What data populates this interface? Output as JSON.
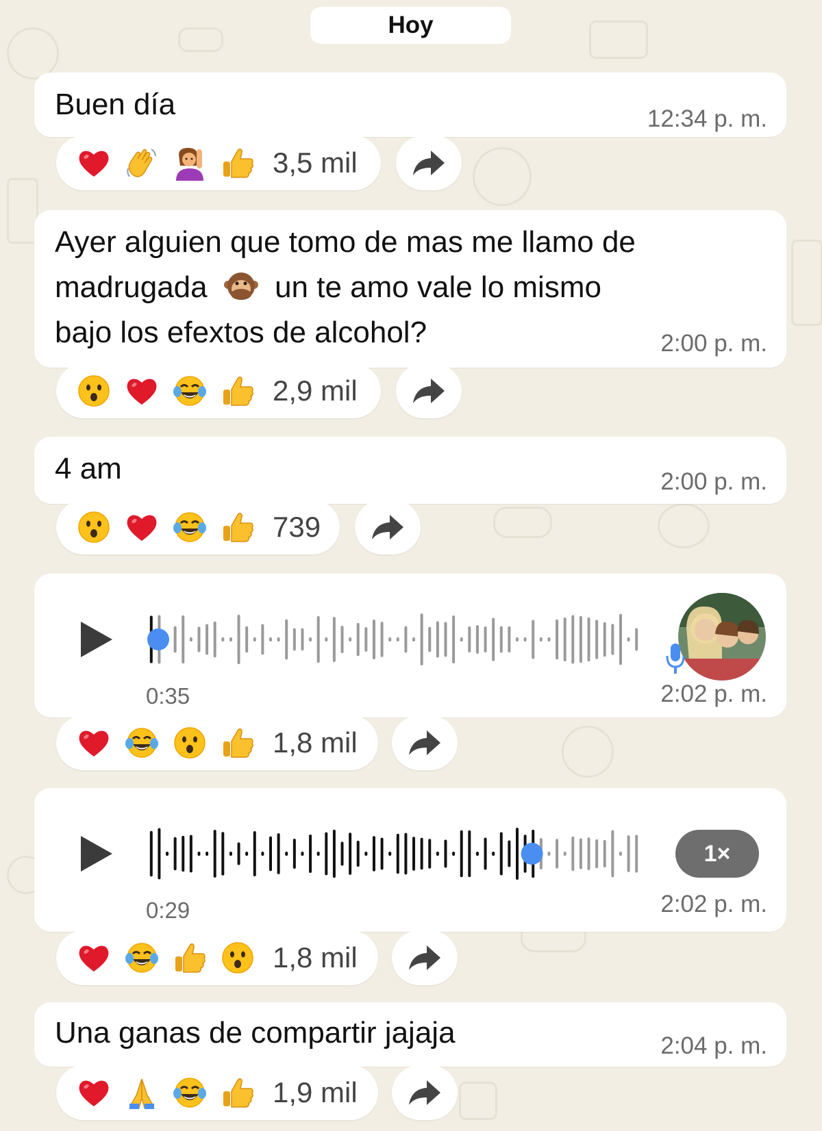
{
  "date_label": "Hoy",
  "colors": {
    "background": "#f3eee4",
    "bubble": "#ffffff",
    "waveform_played": "#111111",
    "waveform_unplayed": "#9a9a9a",
    "progress_dot": "#4a8ef1",
    "speed_badge": "#6e6e6e"
  },
  "messages": [
    {
      "type": "text",
      "lines": [
        "Buen día"
      ],
      "time": "12:34 p. m.",
      "reactions": {
        "emojis": [
          "heart",
          "wave",
          "raising-hand",
          "thumbs-up"
        ],
        "count": "3,5 mil"
      }
    },
    {
      "type": "text",
      "lines": [
        "Ayer alguien que tomo de mas me llamo de",
        "madrugada",
        "un te amo vale lo mismo",
        "bajo los efextos de alcohol?"
      ],
      "inline_emoji": "see-no-evil-monkey",
      "time": "2:00 p. m.",
      "reactions": {
        "emojis": [
          "surprised",
          "heart",
          "tears-of-joy",
          "thumbs-up"
        ],
        "count": "2,9 mil"
      }
    },
    {
      "type": "text",
      "lines": [
        "4 am"
      ],
      "time": "2:00 p. m.",
      "reactions": {
        "emojis": [
          "surprised",
          "heart",
          "tears-of-joy",
          "thumbs-up"
        ],
        "count": "739"
      }
    },
    {
      "type": "voice",
      "duration": "0:35",
      "time": "2:02 p. m.",
      "progress": 0.0,
      "status_icon": "microphone-icon",
      "reactions": {
        "emojis": [
          "heart",
          "tears-of-joy",
          "surprised",
          "thumbs-up"
        ],
        "count": "1,8 mil"
      }
    },
    {
      "type": "voice",
      "duration": "0:29",
      "time": "2:02 p. m.",
      "progress": 0.78,
      "speed": "1×",
      "reactions": {
        "emojis": [
          "heart",
          "tears-of-joy",
          "thumbs-up",
          "surprised"
        ],
        "count": "1,8 mil"
      }
    },
    {
      "type": "text",
      "lines": [
        "Una ganas de compartir jajaja"
      ],
      "time": "2:04 p. m.",
      "reactions": {
        "emojis": [
          "heart",
          "folded-hands",
          "tears-of-joy",
          "thumbs-up"
        ],
        "count": "1,9 mil"
      }
    }
  ]
}
